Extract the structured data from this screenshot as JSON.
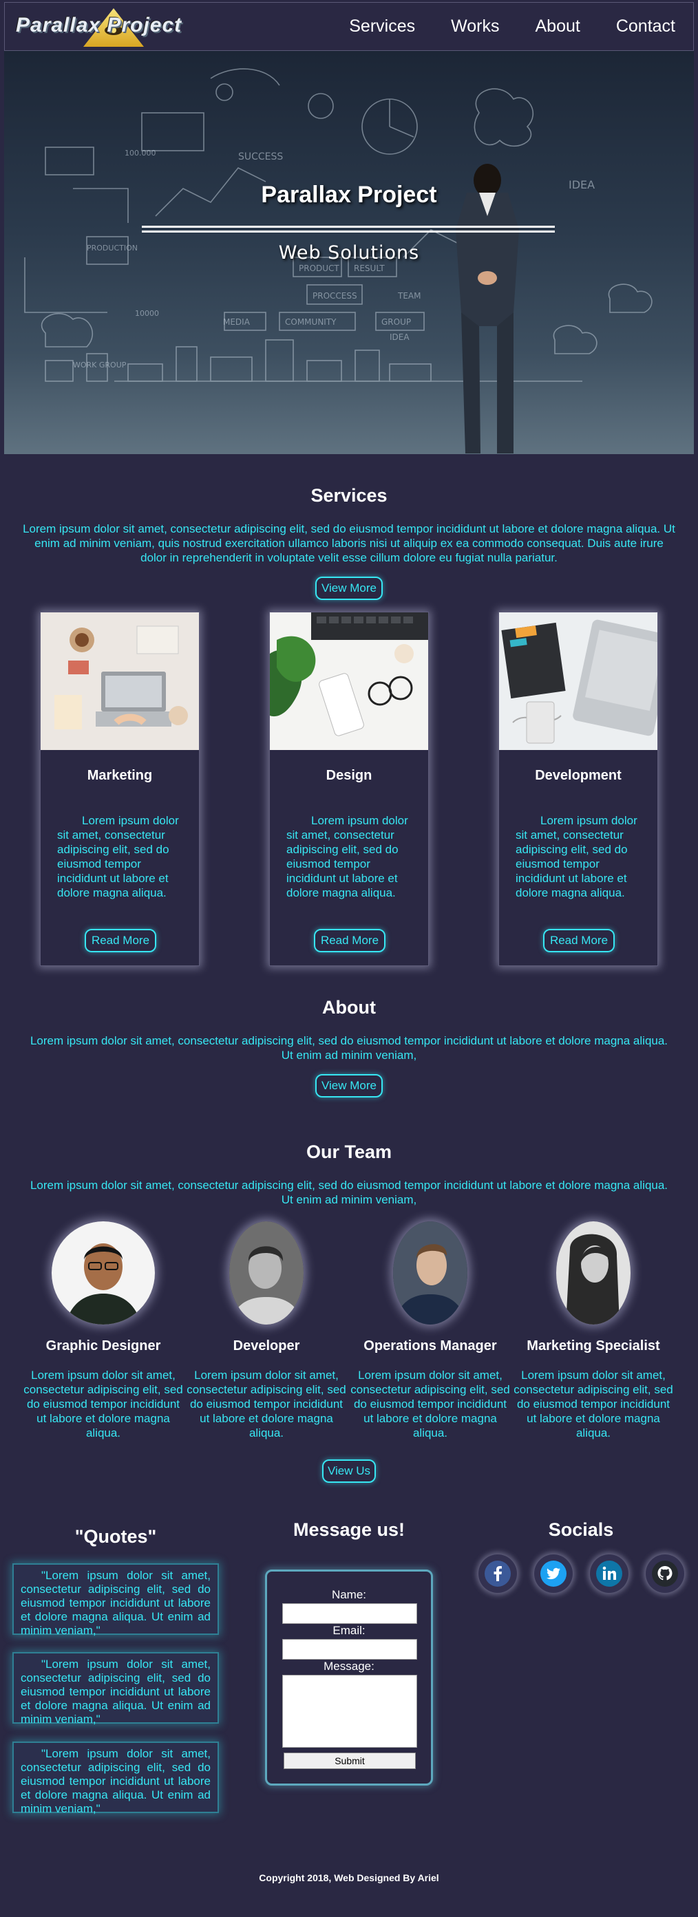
{
  "nav": {
    "logo_text": "Parallax Project",
    "links": [
      "Services",
      "Works",
      "About",
      "Contact"
    ]
  },
  "hero": {
    "title": "Parallax Project",
    "subtitle": "Web Solutions",
    "sketch_labels": [
      "SUCCESS",
      "PRODUCTION",
      "PRODUCT",
      "RESULT",
      "PROCCESS",
      "TEAM",
      "COMMUNITY",
      "GROUP",
      "MEDIA",
      "IDEA",
      "WORK GROUP",
      "IDEA",
      "10000",
      "100.000"
    ]
  },
  "services": {
    "title": "Services",
    "text": "Lorem ipsum dolor sit amet, consectetur adipiscing elit, sed do eiusmod tempor incididunt ut labore et dolore magna aliqua. Ut enim ad minim veniam, quis nostrud exercitation ullamco laboris nisi ut aliquip ex ea commodo consequat. Duis aute irure dolor in reprehenderit in voluptate velit esse cillum dolore eu fugiat nulla pariatur.",
    "button": "View More",
    "cards": [
      {
        "title": "Marketing",
        "text": "Lorem ipsum dolor sit amet, consectetur adipiscing elit, sed do eiusmod tempor incididunt ut labore et dolore magna aliqua.",
        "button": "Read More"
      },
      {
        "title": "Design",
        "text": "Lorem ipsum dolor sit amet, consectetur adipiscing elit, sed do eiusmod tempor incididunt ut labore et dolore magna aliqua.",
        "button": "Read More"
      },
      {
        "title": "Development",
        "text": "Lorem ipsum dolor sit amet, consectetur adipiscing elit, sed do eiusmod tempor incididunt ut labore et dolore magna aliqua.",
        "button": "Read More"
      }
    ]
  },
  "about": {
    "title": "About",
    "text": "Lorem ipsum dolor sit amet, consectetur adipiscing elit, sed do eiusmod tempor incididunt ut labore et dolore magna aliqua. Ut enim ad minim veniam,",
    "button": "View More"
  },
  "team": {
    "title": "Our Team",
    "text": "Lorem ipsum dolor sit amet, consectetur adipiscing elit, sed do eiusmod tempor incididunt ut labore et dolore magna aliqua. Ut enim ad minim veniam,",
    "button": "View Us",
    "members": [
      {
        "role": "Graphic Designer",
        "text": "Lorem ipsum dolor sit amet, consectetur adipiscing elit, sed do eiusmod tempor incididunt ut labore et dolore magna aliqua."
      },
      {
        "role": "Developer",
        "text": "Lorem ipsum dolor sit amet, consectetur adipiscing elit, sed do eiusmod tempor incididunt ut labore et dolore magna aliqua."
      },
      {
        "role": "Operations Manager",
        "text": "Lorem ipsum dolor sit amet, consectetur adipiscing elit, sed do eiusmod tempor incididunt ut labore et dolore magna aliqua."
      },
      {
        "role": "Marketing Specialist",
        "text": "Lorem ipsum dolor sit amet, consectetur adipiscing elit, sed do eiusmod tempor incididunt ut labore et dolore magna aliqua."
      }
    ]
  },
  "quotes": {
    "title": "\"Quotes\"",
    "items": [
      "\"Lorem ipsum dolor sit amet, consectetur adipiscing elit, sed do eiusmod tempor incididunt ut labore et dolore magna aliqua. Ut enim ad minim veniam,\"",
      "\"Lorem ipsum dolor sit amet, consectetur adipiscing elit, sed do eiusmod tempor incididunt ut labore et dolore magna aliqua. Ut enim ad minim veniam,\"",
      "\"Lorem ipsum dolor sit amet, consectetur adipiscing elit, sed do eiusmod tempor incididunt ut labore et dolore magna aliqua. Ut enim ad minim veniam,\""
    ]
  },
  "contact": {
    "title": "Message us!",
    "name_label": "Name:",
    "email_label": "Email:",
    "message_label": "Message:",
    "submit": "Submit"
  },
  "socials": {
    "title": "Socials",
    "icons": [
      "facebook-icon",
      "twitter-icon",
      "linkedin-icon",
      "github-icon"
    ],
    "colors": {
      "facebook": "#3b5998",
      "twitter": "#1da1f2",
      "linkedin": "#0e76a8",
      "github": "#24292e"
    }
  },
  "footer": {
    "text": "Copyright 2018, Web Designed By Ariel"
  },
  "theme": {
    "background": "#2a2843",
    "accent": "#37e6f2"
  }
}
